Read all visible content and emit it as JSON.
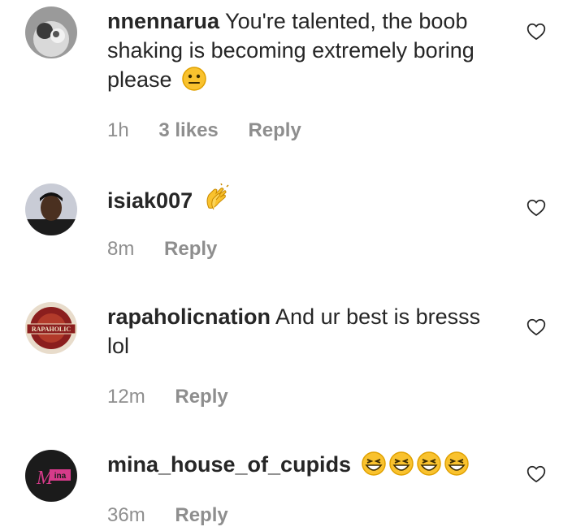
{
  "comments": [
    {
      "username": "nnennarua",
      "text": "You're talented, the boob shaking is becoming extremely boring please",
      "emoji": "neutral-face",
      "time": "1h",
      "likes": "3 likes",
      "reply": "Reply"
    },
    {
      "username": "isiak007",
      "text": "",
      "emoji": "clapping-hands",
      "time": "8m",
      "reply": "Reply"
    },
    {
      "username": "rapaholicnation",
      "text": "And ur best is bresss lol",
      "time": "12m",
      "reply": "Reply",
      "avatar_logo_text": "RAPAHOLIC"
    },
    {
      "username": "mina_house_of_cupids",
      "text": "",
      "emoji": "grinning-squinting-face x4",
      "time": "36m",
      "reply": "Reply",
      "avatar_logo_text": "Mina"
    }
  ],
  "colors": {
    "text": "#262626",
    "meta": "#8e8e8e",
    "emoji_yellow": "#f9c22e",
    "emoji_outline": "#e0a100"
  }
}
